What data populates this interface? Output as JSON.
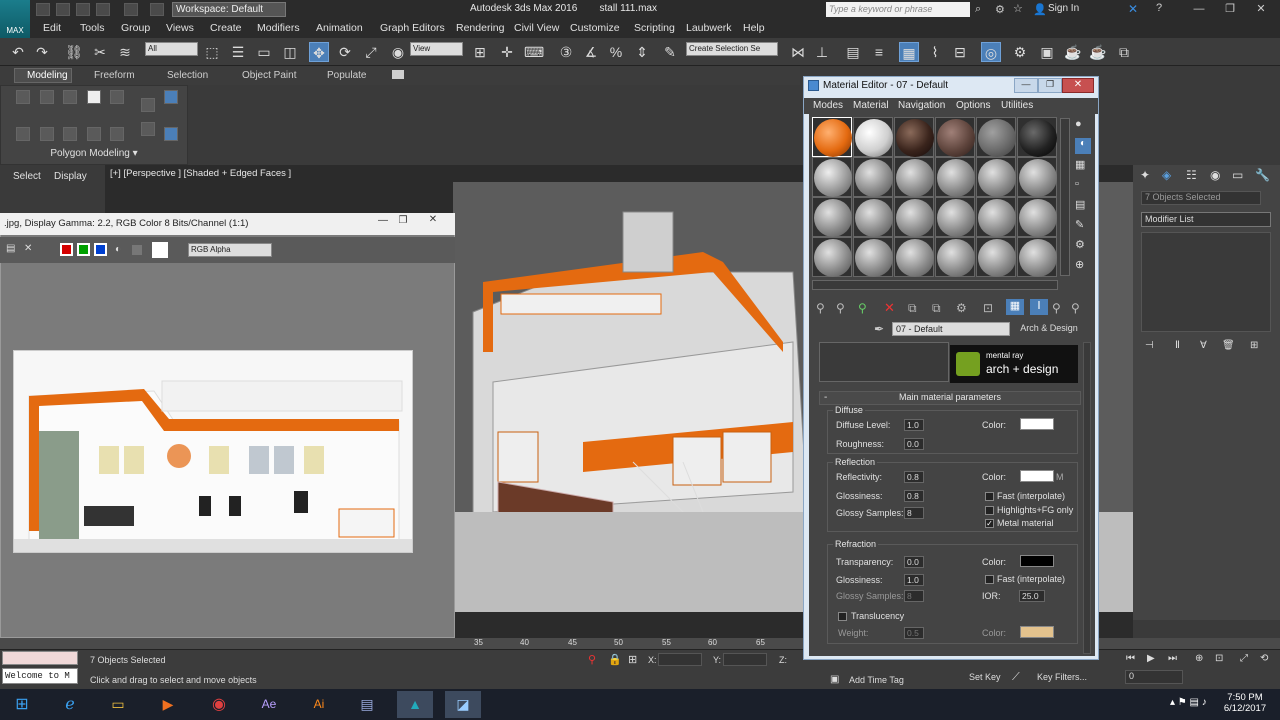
{
  "app": {
    "title": "Autodesk 3ds Max 2016",
    "file": "stall 111.max",
    "workspace": "Workspace: Default",
    "search_placeholder": "Type a keyword or phrase",
    "sign_in": "Sign In",
    "logo": "MAX"
  },
  "menus": [
    "Edit",
    "Tools",
    "Group",
    "Views",
    "Create",
    "Modifiers",
    "Animation",
    "Graph Editors",
    "Rendering",
    "Civil View",
    "Customize",
    "Scripting",
    "Laubwerk",
    "Help"
  ],
  "toolbar": {
    "selection_filter": "All",
    "ref_coord": "View",
    "named_selection": "Create Selection Se"
  },
  "ribbon": {
    "tabs": [
      "Modeling",
      "Freeform",
      "Selection",
      "Object Paint",
      "Populate"
    ],
    "panel_label": "Polygon Modeling",
    "sub_tabs": [
      "Select",
      "Display"
    ]
  },
  "viewport": {
    "label": "[+] [Perspective ] [Shaded + Edged Faces ]"
  },
  "frame_window": {
    "title": ".jpg, Display Gamma: 2.2, RGB Color 8 Bits/Channel (1:1)",
    "channel": "RGB Alpha"
  },
  "material_editor": {
    "title": "Material Editor - 07 - Default",
    "menus": [
      "Modes",
      "Material",
      "Navigation",
      "Options",
      "Utilities"
    ],
    "material_name": "07 - Default",
    "material_type": "Arch & Design",
    "badge_top": "mental ray",
    "badge_bottom": "arch + design",
    "rollout": "Main material parameters",
    "diffuse": {
      "title": "Diffuse",
      "level_label": "Diffuse Level:",
      "level": "1.0",
      "rough_label": "Roughness:",
      "rough": "0.0",
      "color_label": "Color:"
    },
    "reflection": {
      "title": "Reflection",
      "refl_label": "Reflectivity:",
      "refl": "0.8",
      "gloss_label": "Glossiness:",
      "gloss": "0.8",
      "samples_label": "Glossy Samples:",
      "samples": "8",
      "color_label": "Color:",
      "m": "M",
      "fast": "Fast (interpolate)",
      "highlights": "Highlights+FG only",
      "metal": "Metal material"
    },
    "refraction": {
      "title": "Refraction",
      "trans_label": "Transparency:",
      "trans": "0.0",
      "gloss_label": "Glossiness:",
      "gloss": "1.0",
      "samples_label": "Glossy Samples:",
      "samples": "8",
      "color_label": "Color:",
      "ior_label": "IOR:",
      "ior": "25.0",
      "fast": "Fast (interpolate)",
      "translucency": "Translucency",
      "weight_label": "Weight:",
      "weight": "0.5"
    }
  },
  "command_panel": {
    "selection": "7 Objects Selected",
    "modifier_list": "Modifier List"
  },
  "timeline": {
    "ticks": [
      "35",
      "40",
      "45",
      "50",
      "55",
      "60",
      "65"
    ]
  },
  "status": {
    "listener": "Welcome to M",
    "selected": "7 Objects Selected",
    "prompt": "Click and drag to select and move objects",
    "x": "X:",
    "y": "Y:",
    "z": "Z:",
    "add_time_tag": "Add Time Tag",
    "set_key": "Set Key",
    "key_filters": "Key Filters...",
    "frame": "0"
  },
  "taskbar": {
    "time": "7:50 PM",
    "date": "6/12/2017"
  },
  "colors": {
    "accent": "#4b7fb8",
    "orange": "#e46a10",
    "ui_dark": "#3c3c3c"
  }
}
